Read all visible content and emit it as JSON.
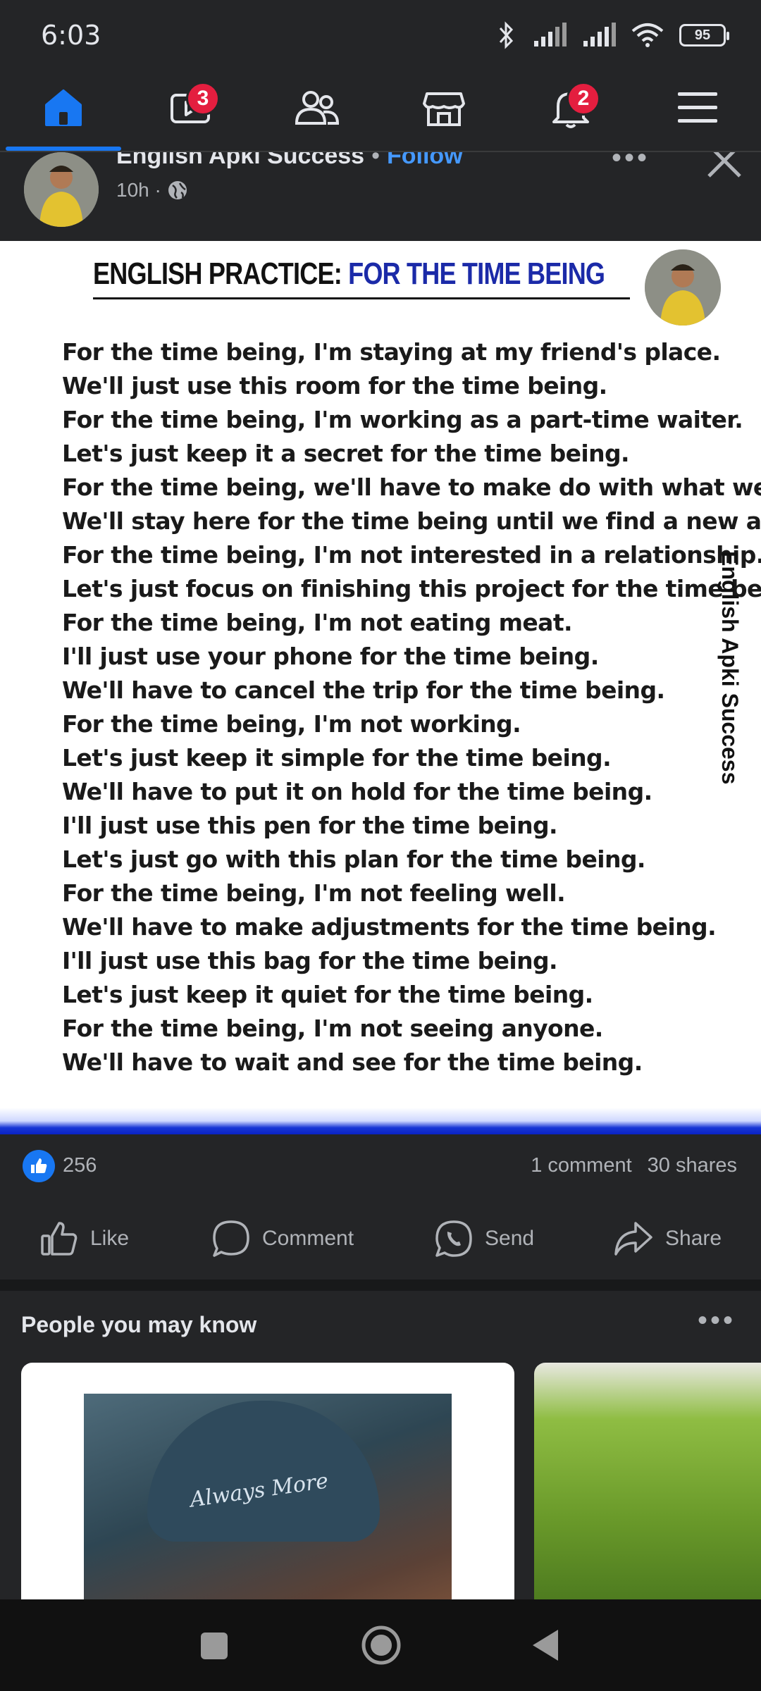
{
  "status": {
    "time": "6:03",
    "battery": "95"
  },
  "nav": {
    "items": [
      {
        "name": "home",
        "active": true
      },
      {
        "name": "video",
        "badge": "3"
      },
      {
        "name": "friends"
      },
      {
        "name": "marketplace"
      },
      {
        "name": "notifications",
        "badge": "2"
      },
      {
        "name": "menu"
      }
    ]
  },
  "post": {
    "author": "English Apki Success",
    "follow": "Follow",
    "time": "10h ·",
    "image": {
      "title_prefix": "ENGLISH PRACTICE: ",
      "title_highlight": "FOR THE TIME BEING",
      "sentences": [
        "For the time being, I'm staying at my friend's place.",
        "We'll just use this room for the time being.",
        "For the time being, I'm working as a part-time waiter.",
        "Let's just keep it a secret for the time being.",
        "For the time being, we'll have to make do with what we have.",
        "We'll stay here for the time being until we find a new apartment.",
        "For the time being, I'm not interested in a relationship.",
        "Let's just focus on finishing this project for the time being.",
        "For the time being, I'm not eating meat.",
        "I'll just use your phone for the time being.",
        "We'll have to cancel the trip for the time being.",
        "For the time being, I'm not working.",
        "Let's just keep it simple for the time being.",
        "We'll have to put it on hold for the time being.",
        "I'll just use this pen for the time being.",
        "Let's just go with this plan for the time being.",
        "For the time being, I'm not feeling well.",
        "We'll have to make adjustments for the time being.",
        "I'll just use this bag for the time being.",
        "Let's just keep it quiet for the time being.",
        "For the time being, I'm not seeing anyone.",
        "We'll have to wait and see for the time being."
      ],
      "vertical_brand": "English Apki Success"
    },
    "reactions": {
      "likes": "256",
      "comments": "1 comment",
      "shares": "30 shares"
    },
    "actions": {
      "like": "Like",
      "comment": "Comment",
      "send": "Send",
      "share": "Share"
    }
  },
  "pymk": {
    "title": "People you may know",
    "card1_cap_text": "Always More"
  },
  "colors": {
    "accent": "#1877f2",
    "badge": "#e41e3f",
    "background": "#242527",
    "title_blue": "#1b2aa8"
  }
}
